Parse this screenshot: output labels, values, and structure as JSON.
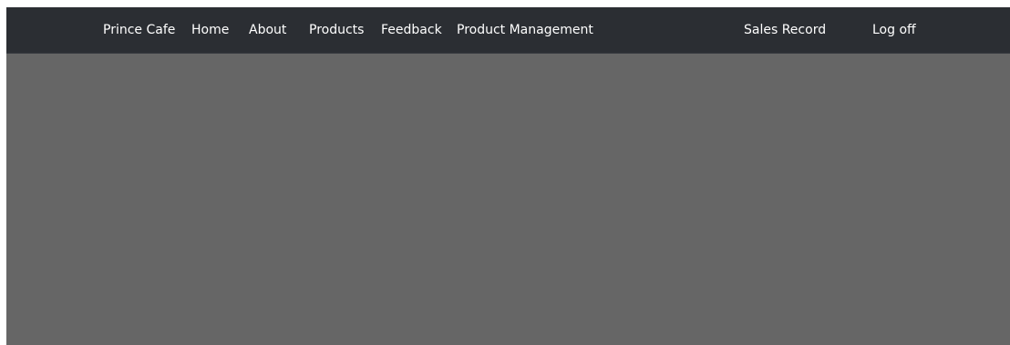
{
  "navbar": {
    "brand": "Prince Cafe",
    "left_links": [
      {
        "label": "Home"
      },
      {
        "label": "About"
      },
      {
        "label": "Products"
      },
      {
        "label": "Feedback"
      },
      {
        "label": "Product Management"
      }
    ],
    "right_links": [
      {
        "label": "Sales Record"
      },
      {
        "label": "Log off"
      }
    ]
  },
  "colors": {
    "navbar_bg": "#2b2e33",
    "content_overlay": "#666666",
    "nav_text": "#ffffff"
  }
}
